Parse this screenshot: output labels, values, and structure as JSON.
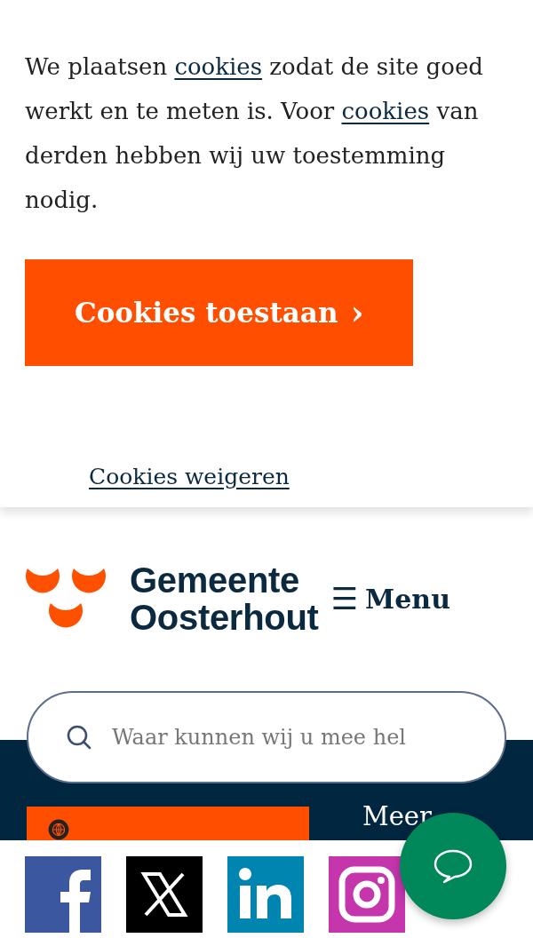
{
  "cookie_banner": {
    "message": [
      {
        "kind": "text",
        "text": "We plaatsen "
      },
      {
        "kind": "link",
        "text": "cookies"
      },
      {
        "kind": "text",
        "text": " zodat de site goed werkt en te meten is. Voor "
      },
      {
        "kind": "link",
        "text": "cookies"
      },
      {
        "kind": "text",
        "text": " van derden hebben wij uw toestemming nodig."
      }
    ],
    "accept_button": {
      "label": "Cookies toestaan",
      "icon": "›"
    },
    "reject_link": "Cookies weigeren"
  },
  "header": {
    "logo_text": [
      "Gemeente",
      "Oosterhout"
    ],
    "menu_button": {
      "icon": "☰",
      "label": "Menu"
    }
  },
  "search": {
    "placeholder": "Waar kunnen wij u mee hel"
  },
  "hero": {
    "read_aloud_button": {
      "kind": "translate"
    },
    "side_text": "Meer"
  },
  "social_links": [
    {
      "kind": "facebook"
    },
    {
      "kind": "x"
    },
    {
      "kind": "linkedin"
    },
    {
      "kind": "instagram"
    }
  ],
  "chat_button": {
    "kind": "chat"
  }
}
